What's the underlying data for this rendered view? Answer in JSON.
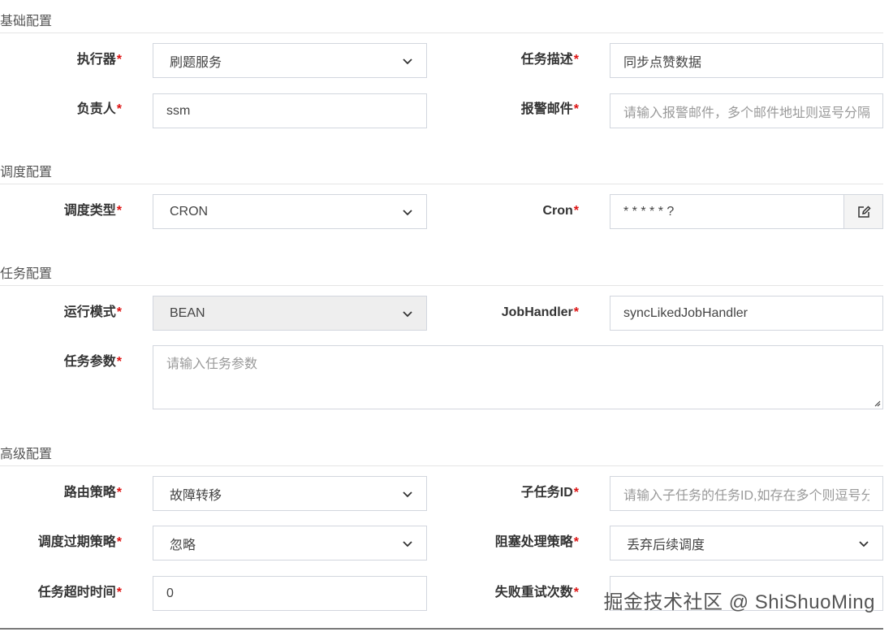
{
  "sections": {
    "basic": "基础配置",
    "schedule": "调度配置",
    "task": "任务配置",
    "advanced": "高级配置"
  },
  "fields": {
    "executor": {
      "label": "执行器",
      "value": "刷题服务"
    },
    "job_desc": {
      "label": "任务描述",
      "value": "同步点赞数据"
    },
    "author": {
      "label": "负责人",
      "value": "ssm"
    },
    "alarm_email": {
      "label": "报警邮件",
      "placeholder": "请输入报警邮件，多个邮件地址则逗号分隔"
    },
    "schedule_type": {
      "label": "调度类型",
      "value": "CRON"
    },
    "cron": {
      "label": "Cron",
      "value": "* * * * * ?"
    },
    "run_mode": {
      "label": "运行模式",
      "value": "BEAN"
    },
    "job_handler": {
      "label": "JobHandler",
      "value": "syncLikedJobHandler"
    },
    "job_param": {
      "label": "任务参数",
      "placeholder": "请输入任务参数"
    },
    "route_strategy": {
      "label": "路由策略",
      "value": "故障转移"
    },
    "child_job_id": {
      "label": "子任务ID",
      "placeholder": "请输入子任务的任务ID,如存在多个则逗号分隔"
    },
    "misfire_strategy": {
      "label": "调度过期策略",
      "value": "忽略"
    },
    "block_strategy": {
      "label": "阻塞处理策略",
      "value": "丢弃后续调度"
    },
    "timeout": {
      "label": "任务超时时间",
      "value": "0"
    },
    "fail_retry": {
      "label": "失败重试次数",
      "value": ""
    }
  },
  "required_mark": "*",
  "watermark": "掘金技术社区 @ ShiShuoMing",
  "icons": {
    "select": "chevron-down-icon",
    "cron_edit": "edit-icon"
  },
  "colors": {
    "required": "#dd1111",
    "border": "#d2d6de",
    "disabled_bg": "#eeeeee"
  }
}
